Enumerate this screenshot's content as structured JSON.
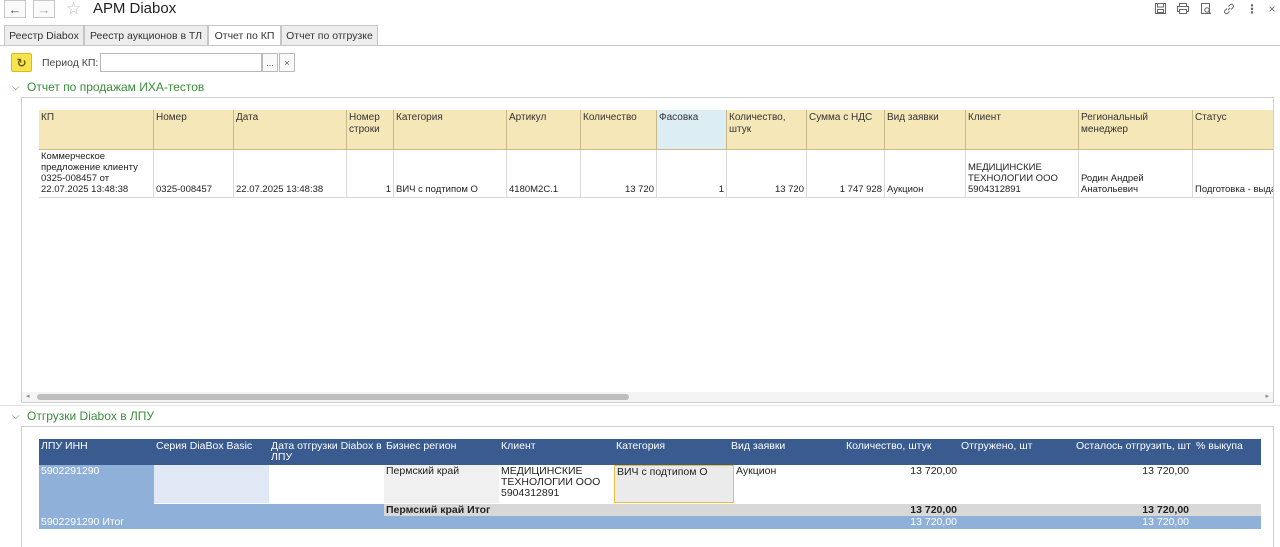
{
  "app": {
    "title": "АРМ Diabox"
  },
  "toolbar_icons": [
    "save-icon",
    "print-icon",
    "preview-icon",
    "link-icon",
    "more-icon",
    "close-icon"
  ],
  "tabs": [
    {
      "label": "Реестр Diabox"
    },
    {
      "label": "Реестр аукционов в ТЛ"
    },
    {
      "label": "Отчет по КП"
    },
    {
      "label": "Отчет по отгрузке"
    }
  ],
  "period": {
    "label": "Период КП:",
    "value": "",
    "select_label": "...",
    "clear_label": "×"
  },
  "sales_section": {
    "title": "Отчет по продажам ИХА-тестов",
    "columns": [
      "КП",
      "Номер",
      "Дата",
      "Номер строки",
      "Категория",
      "Артикул",
      "Количество",
      "Фасовка",
      "Количество, штук",
      "Сумма с НДС",
      "Вид заявки",
      "Клиент",
      "Региональный менеджер",
      "Статус"
    ],
    "rows": [
      {
        "kp": "Коммерческое предложение клиенту 0325-008457 от 22.07.2025 13:48:38",
        "number": "0325-008457",
        "date": "22.07.2025 13:48:38",
        "line": "1",
        "category": "ВИЧ с подтипом О",
        "article": "4180М2С.1",
        "quantity": "13 720",
        "pack": "1",
        "qty_pcs": "13 720",
        "sum_vat": "1 747 928",
        "request_type": "Аукцион",
        "client": "МЕДИЦИНСКИЕ ТЕХНОЛОГИИ ООО 5904312891",
        "manager": "Родин Андрей Анатольевич",
        "status": "Подготовка - выда"
      }
    ]
  },
  "shipments_section": {
    "title": "Отгрузки Diabox в ЛПУ",
    "columns": [
      "ЛПУ ИНН",
      "Серия DiaBox Basic",
      "Дата отгрузки Diabox в ЛПУ",
      "Бизнес регион",
      "Клиент",
      "Категория",
      "Вид заявки",
      "Количество, штук",
      "Отгружено, шт",
      "Осталось отгрузить, шт",
      "% выкупа"
    ],
    "row": {
      "inn": "5902291290",
      "serie": "",
      "ship_date": "",
      "region": "Пермский край",
      "client": "МЕДИЦИНСКИЕ ТЕХНОЛОГИИ ООО 5904312891",
      "category": "ВИЧ с подтипом О",
      "request_type": "Аукцион",
      "qty": "13 720,00",
      "shipped": "",
      "remaining": "13 720,00",
      "percent": ""
    },
    "subtotal": {
      "label": "Пермский край Итог",
      "qty": "13 720,00",
      "remaining": "13 720,00"
    },
    "total": {
      "label": "5902291290 Итог",
      "qty": "13 720,00",
      "remaining": "13 720,00"
    }
  }
}
